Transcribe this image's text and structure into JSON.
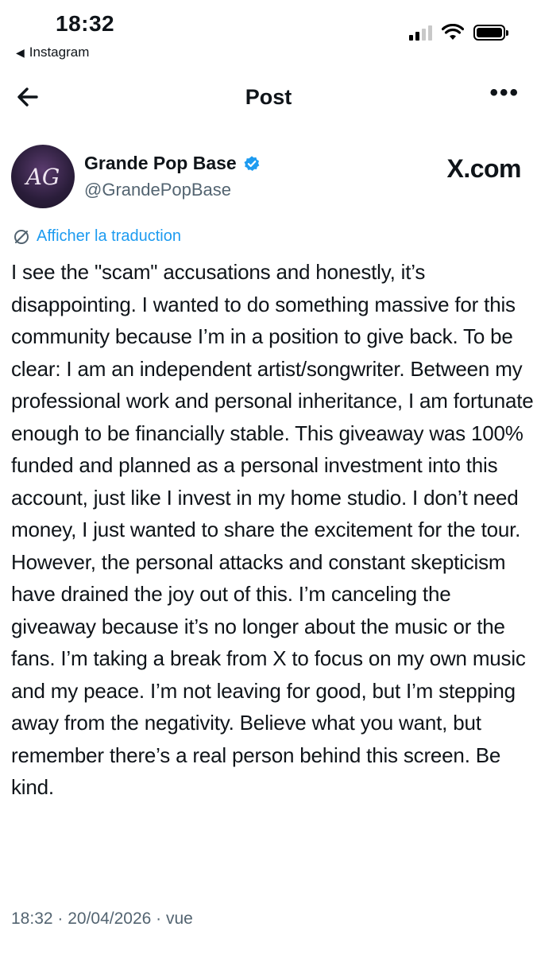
{
  "status_bar": {
    "time": "18:32",
    "back_app": "Instagram"
  },
  "nav": {
    "title": "Post",
    "more": "•••"
  },
  "author": {
    "avatar_initials": "AG",
    "display_name": "Grande Pop Base",
    "handle": "@GrandePopBase",
    "verified": true,
    "verified_color": "#1d9bf0",
    "watermark": "X.com"
  },
  "post": {
    "translate_label": "Afficher la traduction",
    "text": "I see the \"scam\" accusations and honestly, it’s disappointing. I wanted to do something massive for this community because I’m in a position to give back. To be clear: I am an independent artist/songwriter. Between my professional work and personal inheritance, I am fortunate enough to be financially stable. This giveaway was 100% funded and planned as a personal investment into this account, just like I invest in my home studio. I don’t need money, I just wanted to share the excitement for the tour. However, the personal attacks and constant skepticism have drained the joy out of this. I’m canceling the giveaway because it’s no longer about the music or the fans. I’m taking a break from X to focus on my own music and my peace. I’m not leaving for good, but I’m stepping away from the negativity. Believe what you want, but remember there’s a real person behind this screen. Be kind.",
    "meta": "18:32 · 20/04/2026 · vue"
  },
  "icons": {
    "back": "arrow-left-icon",
    "more": "more-horizontal-icon",
    "verified": "verified-badge-icon",
    "translate": "globe-icon"
  },
  "colors": {
    "link": "#1d9bf0",
    "muted": "#536471",
    "text": "#0f1419"
  }
}
